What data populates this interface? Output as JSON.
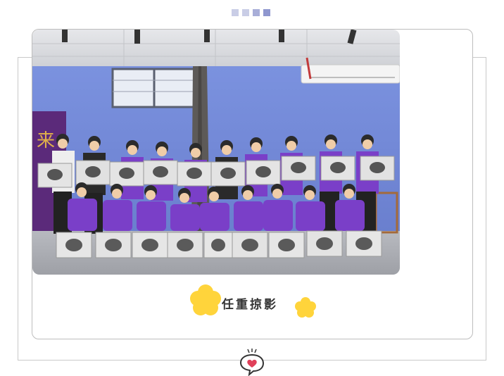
{
  "header": {
    "decor_dots": [
      "dot-1",
      "dot-2",
      "dot-3",
      "dot-4"
    ]
  },
  "photo": {
    "subject": "group-photo-students-holding-sketches",
    "sign_glyph": "来"
  },
  "caption": {
    "text": "任重掠影"
  },
  "footer": {
    "icon": "heart-speech-bubble-icon"
  },
  "colors": {
    "shirt_purple": "#7a3fc8",
    "wall_blue": "#6f86d6",
    "flower_yellow": "#ffd43b",
    "heart_red": "#e0405a"
  }
}
